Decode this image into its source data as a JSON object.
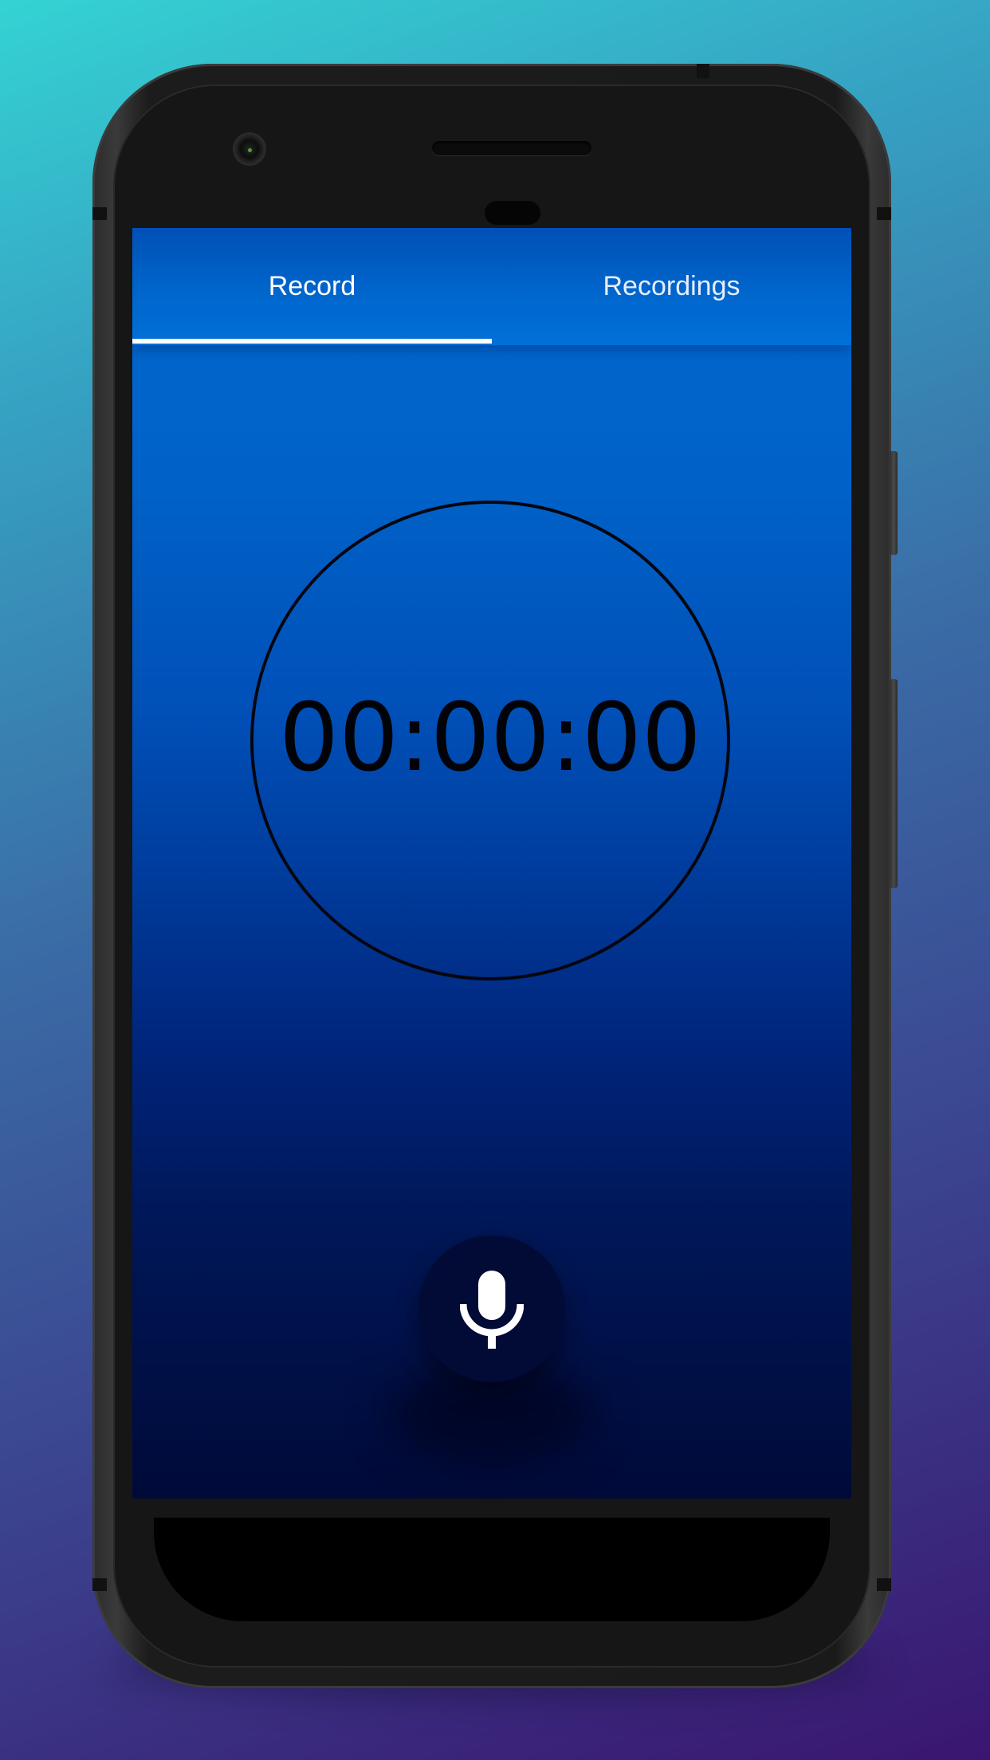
{
  "tabs": [
    {
      "label": "Record",
      "selected": true
    },
    {
      "label": "Recordings",
      "selected": false
    }
  ],
  "timer": {
    "value": "00:00:00"
  },
  "record_button": {
    "icon": "microphone-icon"
  },
  "colors": {
    "app_bar": "#0066cc",
    "tab_indicator": "#ffffff",
    "screen_top": "#0066cc",
    "screen_bottom": "#000a38",
    "mic_button": "#020a36",
    "mic_icon": "#ffffff"
  },
  "device": {
    "frame": "phone-frame",
    "camera": "front-camera-icon"
  }
}
